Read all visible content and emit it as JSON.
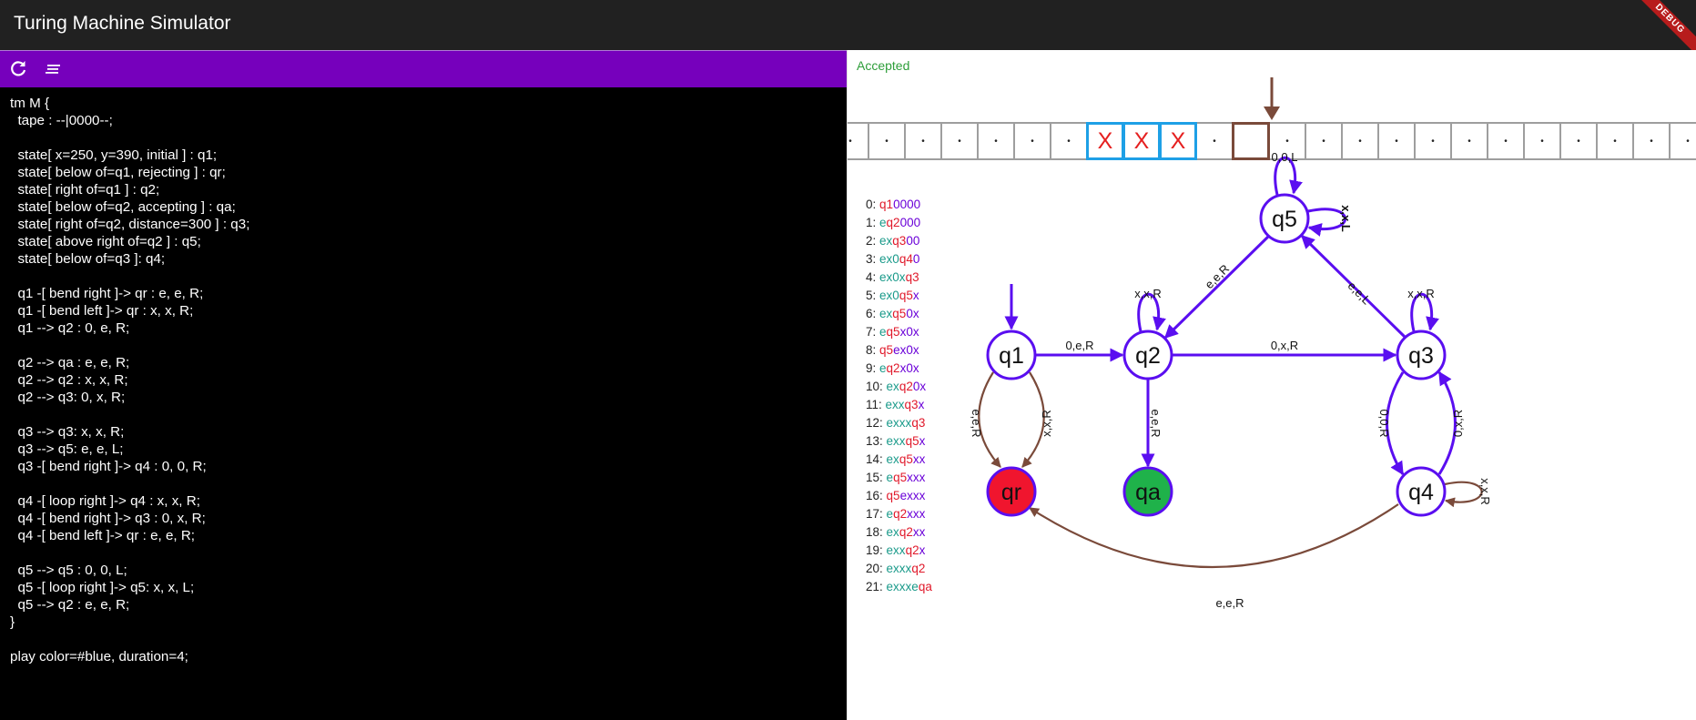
{
  "app": {
    "title": "Turing Machine Simulator",
    "debug_banner": "DEBUG"
  },
  "toolbar": {
    "refresh_icon": "refresh-icon",
    "format_icon": "text-lines-icon"
  },
  "editor": {
    "lines": [
      "tm M {",
      "  tape : --|0000--;",
      "",
      "  state[ x=250, y=390, initial ] : q1;",
      "  state[ below of=q1, rejecting ] : qr;",
      "  state[ right of=q1 ] : q2;",
      "  state[ below of=q2, accepting ] : qa;",
      "  state[ right of=q2, distance=300 ] : q3;",
      "  state[ above right of=q2 ] : q5;",
      "  state[ below of=q3 ]: q4;",
      "",
      "  q1 -[ bend right ]-> qr : e, e, R;",
      "  q1 -[ bend left ]-> qr : x, x, R;",
      "  q1 --> q2 : 0, e, R;",
      "",
      "  q2 --> qa : e, e, R;",
      "  q2 --> q2 : x, x, R;",
      "  q2 --> q3: 0, x, R;",
      "",
      "  q3 --> q3: x, x, R;",
      "  q3 --> q5: e, e, L;",
      "  q3 -[ bend right ]-> q4 : 0, 0, R;",
      "",
      "  q4 -[ loop right ]-> q4 : x, x, R;",
      "  q4 -[ bend right ]-> q3 : 0, x, R;",
      "  q4 -[ bend left ]-> qr : e, e, R;",
      "",
      "  q5 --> q5 : 0, 0, L;",
      "  q5 -[ loop right ]-> q5: x, x, L;",
      "  q5 --> q2 : e, e, R;",
      "}",
      "",
      "play color=#blue, duration=4;"
    ]
  },
  "simulation": {
    "status": "Accepted",
    "status_color": "#2e9e3a",
    "tape_cells": [
      "•",
      "•",
      "•",
      "•",
      "•",
      "•",
      "•",
      "X",
      "X",
      "X",
      "•",
      "",
      "•",
      "•",
      "•",
      "•",
      "•",
      "•",
      "•",
      "•",
      "•",
      "•",
      "•",
      "•"
    ],
    "highlighted_cells": [
      7,
      8,
      9
    ],
    "head_cell": 11,
    "configurations": [
      {
        "index": "0:",
        "parts": [
          [
            "red",
            "q1"
          ],
          [
            "purple",
            "0000"
          ]
        ]
      },
      {
        "index": "1:",
        "parts": [
          [
            "teal",
            "e"
          ],
          [
            "red",
            "q2"
          ],
          [
            "purple",
            "000"
          ]
        ]
      },
      {
        "index": "2:",
        "parts": [
          [
            "teal",
            "ex"
          ],
          [
            "red",
            "q3"
          ],
          [
            "purple",
            "00"
          ]
        ]
      },
      {
        "index": "3:",
        "parts": [
          [
            "teal",
            "ex0"
          ],
          [
            "red",
            "q4"
          ],
          [
            "purple",
            "0"
          ]
        ]
      },
      {
        "index": "4:",
        "parts": [
          [
            "teal",
            "ex0x"
          ],
          [
            "red",
            "q3"
          ]
        ]
      },
      {
        "index": "5:",
        "parts": [
          [
            "teal",
            "ex0"
          ],
          [
            "red",
            "q5"
          ],
          [
            "purple",
            "x"
          ]
        ]
      },
      {
        "index": "6:",
        "parts": [
          [
            "teal",
            "ex"
          ],
          [
            "red",
            "q5"
          ],
          [
            "purple",
            "0x"
          ]
        ]
      },
      {
        "index": "7:",
        "parts": [
          [
            "teal",
            "e"
          ],
          [
            "red",
            "q5"
          ],
          [
            "purple",
            "x0x"
          ]
        ]
      },
      {
        "index": "8:",
        "parts": [
          [
            "red",
            "q5"
          ],
          [
            "purple",
            "ex0x"
          ]
        ]
      },
      {
        "index": "9:",
        "parts": [
          [
            "teal",
            "e"
          ],
          [
            "red",
            "q2"
          ],
          [
            "purple",
            "x0x"
          ]
        ]
      },
      {
        "index": "10:",
        "parts": [
          [
            "teal",
            "ex"
          ],
          [
            "red",
            "q2"
          ],
          [
            "purple",
            "0x"
          ]
        ]
      },
      {
        "index": "11:",
        "parts": [
          [
            "teal",
            "exx"
          ],
          [
            "red",
            "q3"
          ],
          [
            "purple",
            "x"
          ]
        ]
      },
      {
        "index": "12:",
        "parts": [
          [
            "teal",
            "exxx"
          ],
          [
            "red",
            "q3"
          ]
        ]
      },
      {
        "index": "13:",
        "parts": [
          [
            "teal",
            "exx"
          ],
          [
            "red",
            "q5"
          ],
          [
            "purple",
            "x"
          ]
        ]
      },
      {
        "index": "14:",
        "parts": [
          [
            "teal",
            "ex"
          ],
          [
            "red",
            "q5"
          ],
          [
            "purple",
            "xx"
          ]
        ]
      },
      {
        "index": "15:",
        "parts": [
          [
            "teal",
            "e"
          ],
          [
            "red",
            "q5"
          ],
          [
            "purple",
            "xxx"
          ]
        ]
      },
      {
        "index": "16:",
        "parts": [
          [
            "red",
            "q5"
          ],
          [
            "purple",
            "exxx"
          ]
        ]
      },
      {
        "index": "17:",
        "parts": [
          [
            "teal",
            "e"
          ],
          [
            "red",
            "q2"
          ],
          [
            "purple",
            "xxx"
          ]
        ]
      },
      {
        "index": "18:",
        "parts": [
          [
            "teal",
            "ex"
          ],
          [
            "red",
            "q2"
          ],
          [
            "purple",
            "xx"
          ]
        ]
      },
      {
        "index": "19:",
        "parts": [
          [
            "teal",
            "exx"
          ],
          [
            "red",
            "q2"
          ],
          [
            "purple",
            "x"
          ]
        ]
      },
      {
        "index": "20:",
        "parts": [
          [
            "teal",
            "exxx"
          ],
          [
            "red",
            "q2"
          ]
        ]
      },
      {
        "index": "21:",
        "parts": [
          [
            "teal",
            "exxxe"
          ],
          [
            "red",
            "qa"
          ]
        ]
      }
    ]
  },
  "graph": {
    "states": [
      {
        "id": "q1",
        "label": "q1",
        "kind": "initial"
      },
      {
        "id": "q2",
        "label": "q2",
        "kind": "normal"
      },
      {
        "id": "q3",
        "label": "q3",
        "kind": "normal"
      },
      {
        "id": "q4",
        "label": "q4",
        "kind": "normal"
      },
      {
        "id": "q5",
        "label": "q5",
        "kind": "normal"
      },
      {
        "id": "qr",
        "label": "qr",
        "kind": "rejecting"
      },
      {
        "id": "qa",
        "label": "qa",
        "kind": "accepting"
      }
    ],
    "edge_labels": {
      "q1_q2": "0,e,R",
      "q2_q3": "0,x,R",
      "q2_qa": "e,e,R",
      "q2_loop": "x,x,R",
      "q5_q2": "e,e,R",
      "q3_q5": "e,e,L",
      "q3_loop": "x,x,R",
      "q5_loop_top": "0,0,L",
      "q5_loop_right": "x,x,L",
      "q1_qr_left": "e,e,R",
      "q1_qr_right": "x,x,R",
      "q3_q4": "0,0,R",
      "q4_q3": "0,x,R",
      "q4_loop": "x,x,R",
      "q4_qr": "e,e,R"
    },
    "colors": {
      "active": "#5a0ef0",
      "inactive": "#7a4a3a",
      "reject": "#f0152e",
      "accept": "#1fb24a"
    }
  }
}
